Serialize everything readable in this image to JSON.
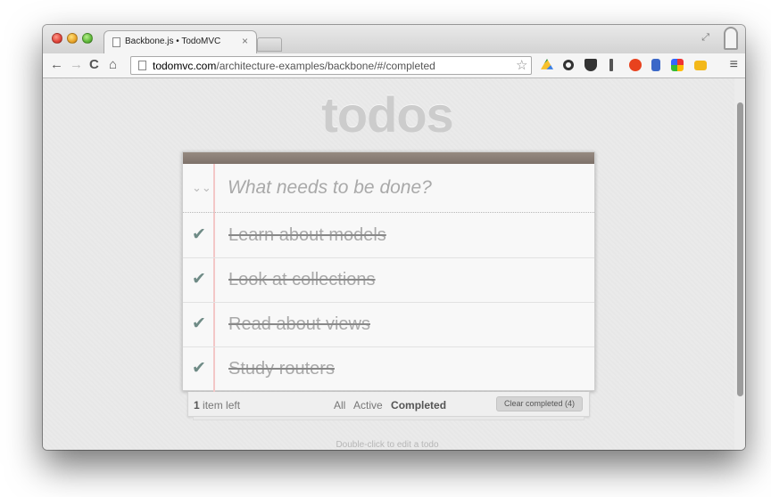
{
  "browser": {
    "tab": {
      "title": "Backbone.js • TodoMVC",
      "close": "×"
    },
    "toolbar": {
      "back": "←",
      "forward": "→",
      "reload": "C",
      "home": "⌂",
      "url_host": "todomvc.com",
      "url_path": "/architecture-examples/backbone/#/completed",
      "star": "☆",
      "menu": "≡"
    },
    "window_resize": "⤢"
  },
  "app": {
    "title": "todos",
    "new_todo_placeholder": "What needs to be done?",
    "toggle_all": "»",
    "check_glyph": "✔",
    "items": [
      {
        "label": "Learn about models",
        "completed": true
      },
      {
        "label": "Look at collections",
        "completed": true
      },
      {
        "label": "Read about views",
        "completed": true
      },
      {
        "label": "Study routers",
        "completed": true
      }
    ],
    "footer": {
      "count_number": "1",
      "count_text": " item left",
      "filters": [
        "All",
        "Active",
        "Completed"
      ],
      "selected_filter": "Completed",
      "clear_button": "Clear completed (4)"
    },
    "info": "Double-click to edit a todo"
  }
}
